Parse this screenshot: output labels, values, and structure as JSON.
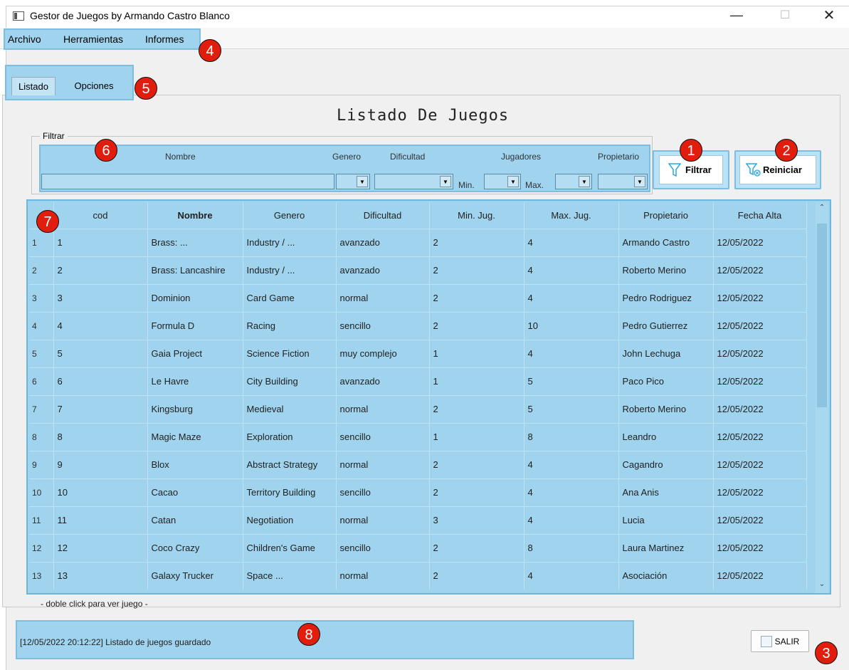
{
  "window": {
    "title": "Gestor de Juegos by Armando Castro Blanco"
  },
  "menu": {
    "items": [
      "Archivo",
      "Herramientas",
      "Informes"
    ]
  },
  "tabs": [
    "Listado",
    "Opciones"
  ],
  "page_title": "Listado De Juegos",
  "filter": {
    "legend": "Filtrar",
    "labels": {
      "nombre": "Nombre",
      "genero": "Genero",
      "dificultad": "Dificultad",
      "jugadores": "Jugadores",
      "propietario": "Propietario",
      "min": "Min.",
      "max": "Max."
    },
    "nombre_value": "",
    "genero_value": "",
    "dificultad_value": "",
    "min_value": "",
    "max_value": "",
    "propietario_value": ""
  },
  "buttons": {
    "filtrar": "Filtrar",
    "reiniciar": "Reiniciar",
    "salir": "SALIR"
  },
  "table": {
    "columns": [
      "cod",
      "Nombre",
      "Genero",
      "Dificultad",
      "Min. Jug.",
      "Max. Jug.",
      "Propietario",
      "Fecha Alta"
    ],
    "rows": [
      [
        "1",
        "1",
        "Brass: ...",
        "Industry / ...",
        "avanzado",
        "2",
        "4",
        "Armando Castro",
        "12/05/2022"
      ],
      [
        "2",
        "2",
        "Brass: Lancashire",
        "Industry / ...",
        "avanzado",
        "2",
        "4",
        "Roberto Merino",
        "12/05/2022"
      ],
      [
        "3",
        "3",
        "Dominion",
        "Card Game",
        "normal",
        "2",
        "4",
        "Pedro Rodriguez",
        "12/05/2022"
      ],
      [
        "4",
        "4",
        "Formula D",
        "Racing",
        "sencillo",
        "2",
        "10",
        "Pedro Gutierrez",
        "12/05/2022"
      ],
      [
        "5",
        "5",
        "Gaia Project",
        "Science Fiction",
        "muy complejo",
        "1",
        "4",
        "John Lechuga",
        "12/05/2022"
      ],
      [
        "6",
        "6",
        "Le Havre",
        "City Building",
        "avanzado",
        "1",
        "5",
        "Paco Pico",
        "12/05/2022"
      ],
      [
        "7",
        "7",
        "Kingsburg",
        "Medieval",
        "normal",
        "2",
        "5",
        "Roberto Merino",
        "12/05/2022"
      ],
      [
        "8",
        "8",
        "Magic Maze",
        "Exploration",
        "sencillo",
        "1",
        "8",
        "Leandro",
        "12/05/2022"
      ],
      [
        "9",
        "9",
        "Blox",
        "Abstract Strategy",
        "normal",
        "2",
        "4",
        "Cagandro",
        "12/05/2022"
      ],
      [
        "10",
        "10",
        "Cacao",
        "Territory Building",
        "sencillo",
        "2",
        "4",
        "Ana Anis",
        "12/05/2022"
      ],
      [
        "11",
        "11",
        "Catan",
        "Negotiation",
        "normal",
        "3",
        "4",
        "Lucia",
        "12/05/2022"
      ],
      [
        "12",
        "12",
        "Coco Crazy",
        "Children's Game",
        "sencillo",
        "2",
        "8",
        "Laura Martinez",
        "12/05/2022"
      ],
      [
        "13",
        "13",
        "Galaxy Trucker",
        "Space ...",
        "normal",
        "2",
        "4",
        "Asociación",
        "12/05/2022"
      ]
    ]
  },
  "hint": "- doble click para ver juego -",
  "status": "[12/05/2022 20:12:22] Listado de juegos guardado",
  "callouts": [
    "1",
    "2",
    "3",
    "4",
    "5",
    "6",
    "7",
    "8"
  ],
  "colors": {
    "highlight": "#9fd3ee",
    "highlight_border": "#7cbde0",
    "callout": "#e11d0d"
  }
}
